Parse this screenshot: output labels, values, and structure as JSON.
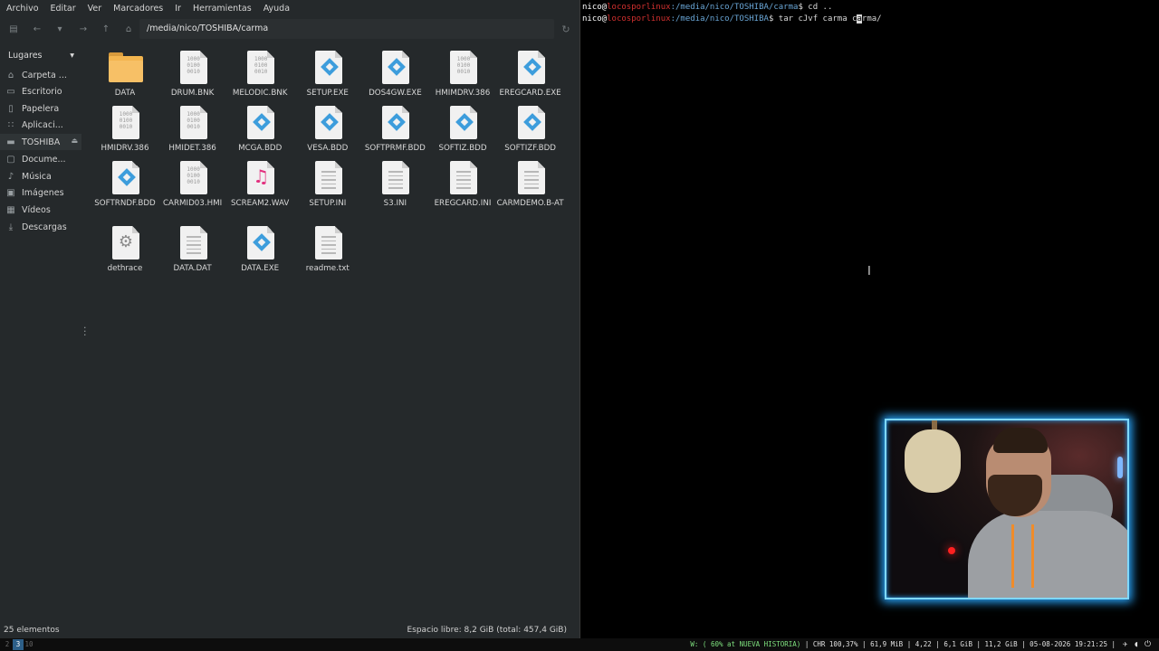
{
  "file_manager": {
    "menu": [
      "Archivo",
      "Editar",
      "Ver",
      "Marcadores",
      "Ir",
      "Herramientas",
      "Ayuda"
    ],
    "path": "/media/nico/TOSHIBA/carma",
    "sidebar": {
      "header": "Lugares",
      "items": [
        {
          "label": "Carpeta ...",
          "icon": "home-icon"
        },
        {
          "label": "Escritorio",
          "icon": "desktop-icon"
        },
        {
          "label": "Papelera",
          "icon": "trash-icon"
        },
        {
          "label": "Aplicaci...",
          "icon": "apps-icon"
        },
        {
          "label": "TOSHIBA",
          "icon": "drive-icon"
        },
        {
          "label": "Docume...",
          "icon": "documents-icon"
        },
        {
          "label": "Música",
          "icon": "music-icon"
        },
        {
          "label": "Imágenes",
          "icon": "pictures-icon"
        },
        {
          "label": "Vídeos",
          "icon": "videos-icon"
        },
        {
          "label": "Descargas",
          "icon": "downloads-icon"
        }
      ]
    },
    "files": [
      {
        "name": "DATA",
        "type": "folder"
      },
      {
        "name": "DRUM.BNK",
        "type": "binary"
      },
      {
        "name": "MELODIC.BNK",
        "type": "binary"
      },
      {
        "name": "SETUP.EXE",
        "type": "exe"
      },
      {
        "name": "DOS4GW.EXE",
        "type": "exe"
      },
      {
        "name": "HMIMDRV.386",
        "type": "binary"
      },
      {
        "name": "EREGCARD.EXE",
        "type": "exe"
      },
      {
        "name": "HMIDRV.386",
        "type": "binary"
      },
      {
        "name": "HMIDET.386",
        "type": "binary"
      },
      {
        "name": "MCGA.BDD",
        "type": "exe"
      },
      {
        "name": "VESA.BDD",
        "type": "exe"
      },
      {
        "name": "SOFTPRMF.BDD",
        "type": "exe"
      },
      {
        "name": "SOFTIZ.BDD",
        "type": "exe"
      },
      {
        "name": "SOFTIZF.BDD",
        "type": "exe"
      },
      {
        "name": "SOFTRNDF.BDD",
        "type": "exe"
      },
      {
        "name": "CARMID03.HMI",
        "type": "binary"
      },
      {
        "name": "SCREAM2.WAV",
        "type": "audio"
      },
      {
        "name": "SETUP.INI",
        "type": "text"
      },
      {
        "name": "S3.INI",
        "type": "text"
      },
      {
        "name": "EREGCARD.INI",
        "type": "text"
      },
      {
        "name": "CARMDEMO.B-AT",
        "type": "text"
      },
      {
        "name": "dethrace",
        "type": "gear"
      },
      {
        "name": "DATA.DAT",
        "type": "text"
      },
      {
        "name": "DATA.EXE",
        "type": "exe"
      },
      {
        "name": "readme.txt",
        "type": "text"
      }
    ],
    "binary_glyph": "1000\n0100\n0010",
    "status": {
      "count": "25 elementos",
      "free": "Espacio libre: 8,2 GiB (total: 457,4 GiB)"
    }
  },
  "terminal": {
    "lines": [
      {
        "user": "nico",
        "host": "locosporlinux",
        "path": ":/media/nico/TOSHIBA/carma",
        "cmd": "$ cd .."
      },
      {
        "user": "nico",
        "host": "locosporlinux",
        "path": ":/media/nico/TOSHIBA",
        "cmd_before": "$ tar cJvf carma c",
        "cursor": "a",
        "cmd_after": "rma/"
      }
    ],
    "at": "@"
  },
  "panel": {
    "workspaces": [
      "2",
      "3",
      "10"
    ],
    "active_workspace": "3",
    "wifi": "W: ( 60% at NUEVA HISTORIA)",
    "stats": " | CHR 100,37% | 61,9 MiB | 4,22 | 6,1 GiB | 11,2 GiB | 05-08-2026 19:21:25 |"
  }
}
